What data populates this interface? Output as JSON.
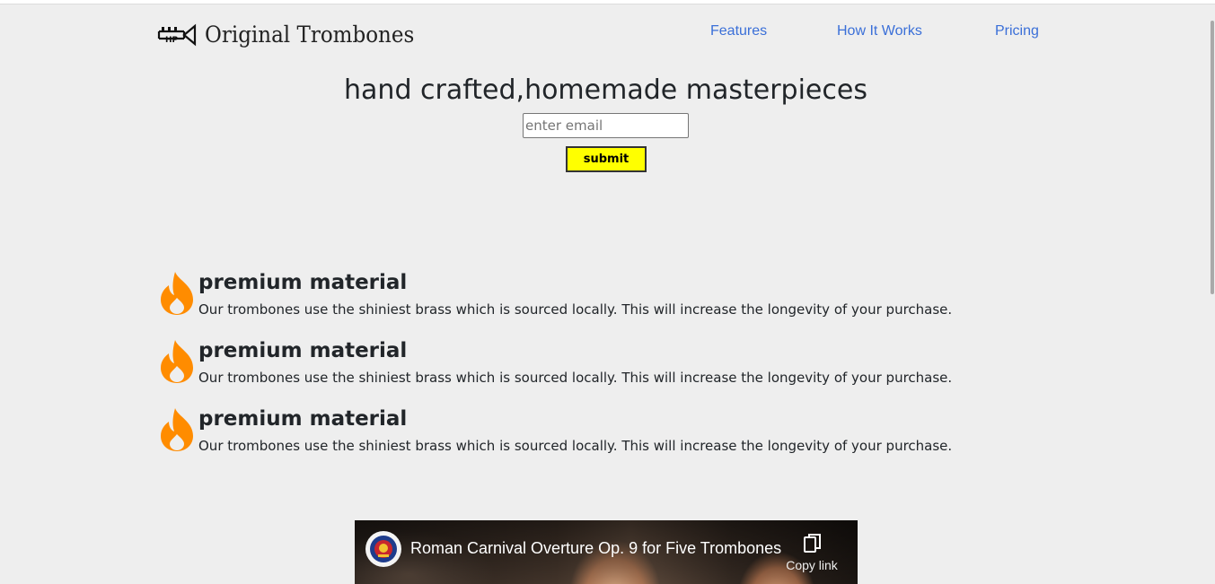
{
  "header": {
    "brand": "Original Trombones",
    "nav": [
      {
        "label": "Features"
      },
      {
        "label": "How It Works"
      },
      {
        "label": "Pricing"
      }
    ]
  },
  "hero": {
    "title": "hand crafted,homemade masterpieces",
    "email_placeholder": "enter email",
    "email_value": "",
    "submit_label": "submit"
  },
  "features": [
    {
      "icon": "fire-icon",
      "title": "premium material",
      "description": "Our trombones use the shiniest brass which is sourced locally. This will increase the longevity of your purchase."
    },
    {
      "icon": "fire-icon",
      "title": "premium material",
      "description": "Our trombones use the shiniest brass which is sourced locally. This will increase the longevity of your purchase."
    },
    {
      "icon": "fire-icon",
      "title": "premium material",
      "description": "Our trombones use the shiniest brass which is sourced locally. This will increase the longevity of your purchase."
    }
  ],
  "video": {
    "title": "Roman Carnival Overture Op. 9 for Five Trombones",
    "copy_link_label": "Copy link"
  },
  "colors": {
    "background": "#eeeeee",
    "nav_link": "#3a6fd8",
    "submit_button": "#ffff00",
    "fire_icon": "#ff8c00"
  }
}
